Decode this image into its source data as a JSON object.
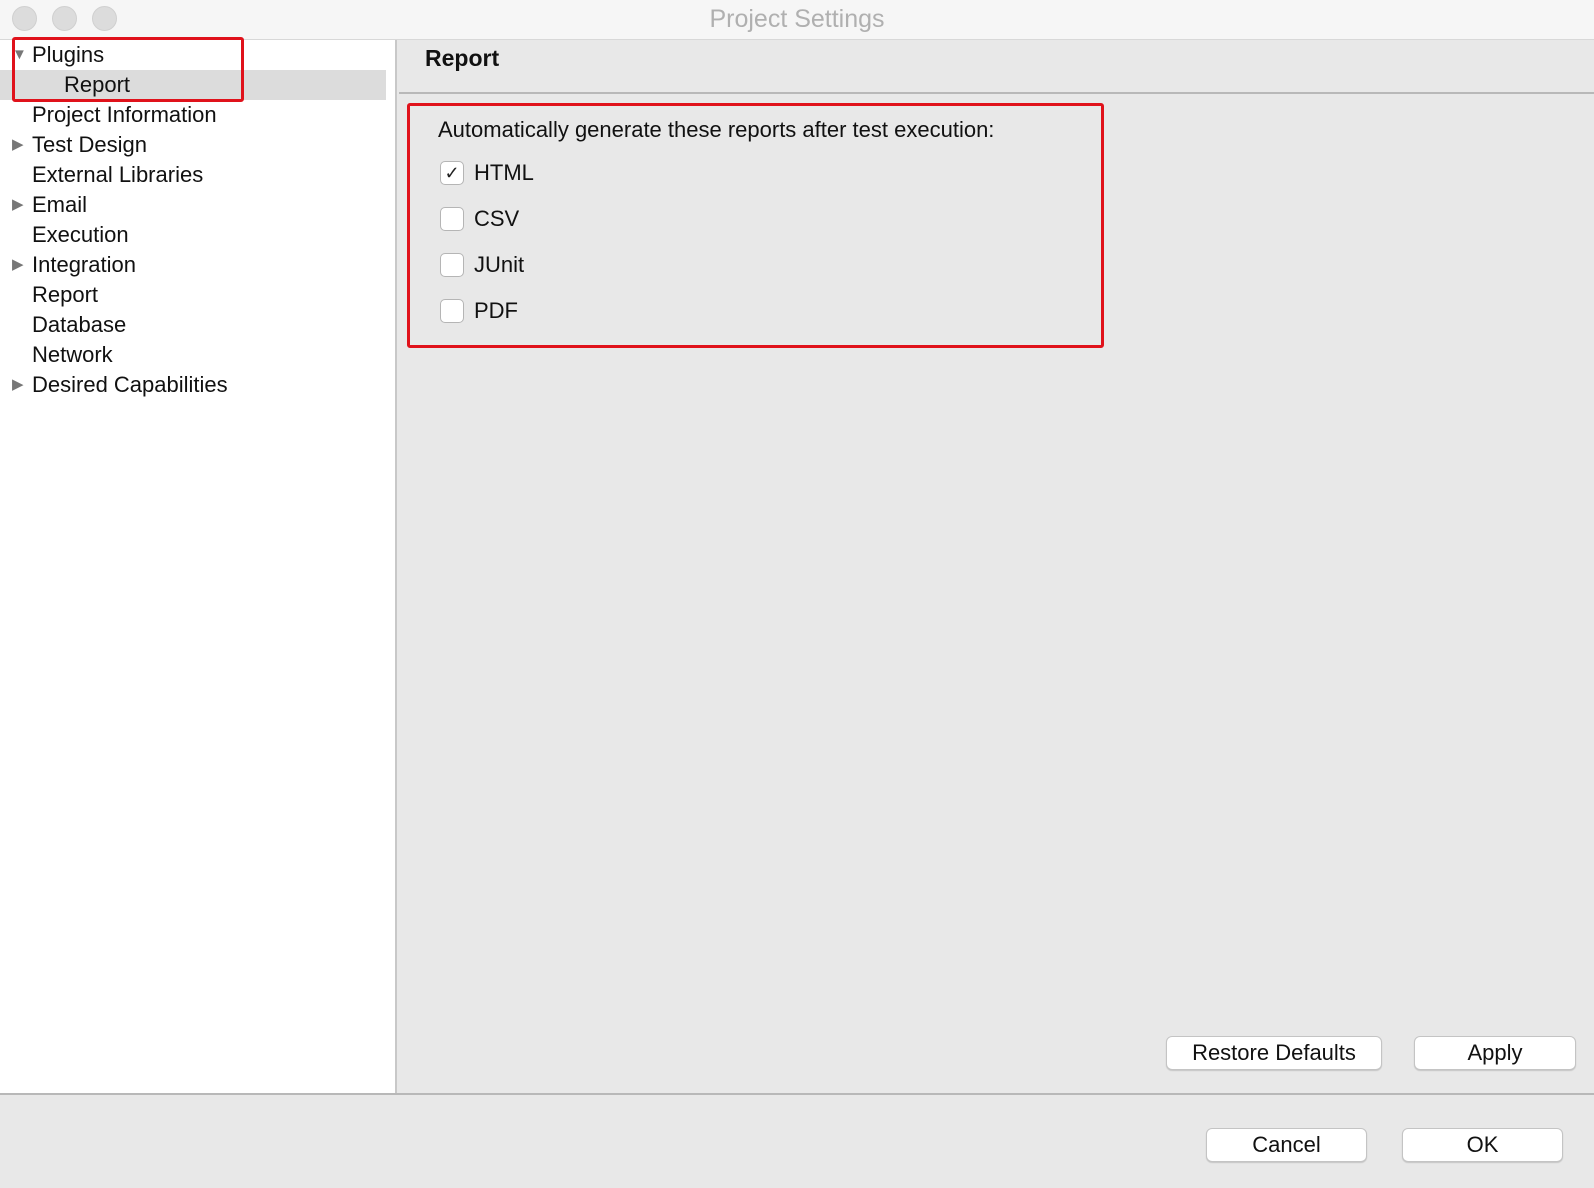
{
  "window": {
    "title": "Project Settings"
  },
  "sidebar": {
    "items": [
      {
        "label": "Plugins",
        "expander": "expanded",
        "indent": 0
      },
      {
        "label": "Report",
        "expander": "none",
        "indent": 1,
        "selected": true
      },
      {
        "label": "Project Information",
        "expander": "none",
        "indent": 0
      },
      {
        "label": "Test Design",
        "expander": "collapsed",
        "indent": 0
      },
      {
        "label": "External Libraries",
        "expander": "none",
        "indent": 0
      },
      {
        "label": "Email",
        "expander": "collapsed",
        "indent": 0
      },
      {
        "label": "Execution",
        "expander": "none",
        "indent": 0
      },
      {
        "label": "Integration",
        "expander": "collapsed",
        "indent": 0
      },
      {
        "label": "Report",
        "expander": "none",
        "indent": 0
      },
      {
        "label": "Database",
        "expander": "none",
        "indent": 0
      },
      {
        "label": "Network",
        "expander": "none",
        "indent": 0
      },
      {
        "label": "Desired Capabilities",
        "expander": "collapsed",
        "indent": 0
      }
    ]
  },
  "main": {
    "title": "Report",
    "description": "Automatically generate these reports after test execution:",
    "options": [
      {
        "label": "HTML",
        "checked": true
      },
      {
        "label": "CSV",
        "checked": false
      },
      {
        "label": "JUnit",
        "checked": false
      },
      {
        "label": "PDF",
        "checked": false
      }
    ],
    "restore_label": "Restore Defaults",
    "apply_label": "Apply"
  },
  "footer": {
    "cancel_label": "Cancel",
    "ok_label": "OK"
  },
  "colors": {
    "highlight": "#e0121b"
  }
}
